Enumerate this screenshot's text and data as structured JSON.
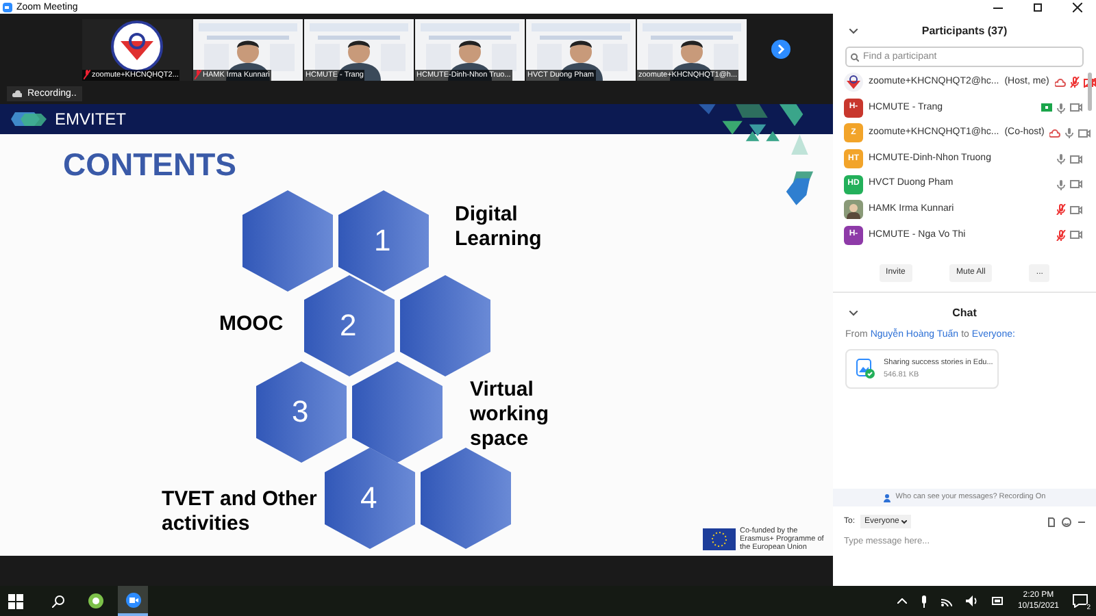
{
  "window": {
    "title": "Zoom Meeting"
  },
  "video_strip": [
    {
      "kind": "logo",
      "name": "zoomute+KHCNQHQT2...",
      "muted": true
    },
    {
      "kind": "picture",
      "name": "HAMK Irma Kunnari",
      "muted": true
    },
    {
      "kind": "picture",
      "name": "HCMUTE - Trang",
      "muted": false
    },
    {
      "kind": "picture",
      "name": "HCMUTE-Dinh-Nhon Truo...",
      "muted": false
    },
    {
      "kind": "picture",
      "name": "HVCT Duong Pham",
      "muted": false
    },
    {
      "kind": "picture",
      "name": "zoomute+KHCNQHQT1@h...",
      "muted": false
    }
  ],
  "recording": "Recording..",
  "slide": {
    "brand": "EMVITET",
    "title": "CONTENTS",
    "items": [
      {
        "number": "1",
        "label": "Digital Learning"
      },
      {
        "number": "2",
        "label": "MOOC"
      },
      {
        "number": "3",
        "label": "Virtual working space"
      },
      {
        "number": "4",
        "label": "TVET and Other activities"
      }
    ],
    "funding": "Co-funded by the Erasmus+ Programme of the European Union"
  },
  "participants": {
    "title": "Participants (37)",
    "search": {
      "placeholder": "Find a participant"
    },
    "rows": [
      {
        "kind": "logo",
        "name": "zoomute+KHCNQHQT2@hc...",
        "role": "(Host, me)",
        "cloud_recording": true,
        "screen_sharing": false,
        "mic_muted": true,
        "video_off": true
      },
      {
        "kind": "initials",
        "initials": "H-",
        "color": "#c8372d",
        "name": "HCMUTE - Trang",
        "cloud_recording": false,
        "screen_sharing": true,
        "mic_muted": false,
        "video_off": false
      },
      {
        "kind": "initials",
        "initials": "Z",
        "color": "#f2a42a",
        "name": "zoomute+KHCNQHQT1@hc...",
        "role": "(Co-host)",
        "cloud_recording": true,
        "screen_sharing": false,
        "mic_muted": false,
        "video_off": false
      },
      {
        "kind": "initials",
        "initials": "HT",
        "color": "#f2a42a",
        "name": "HCMUTE-Dinh-Nhon Truong",
        "cloud_recording": false,
        "screen_sharing": false,
        "mic_muted": false,
        "video_off": false
      },
      {
        "kind": "initials",
        "initials": "HD",
        "color": "#23b05a",
        "name": "HVCT Duong Pham",
        "cloud_recording": false,
        "screen_sharing": false,
        "mic_muted": false,
        "video_off": false
      },
      {
        "name": "HAMK Irma Kunnari",
        "cloud_recording": false,
        "screen_sharing": false,
        "mic_muted": true,
        "video_off": false
      },
      {
        "kind": "initials",
        "initials": "H-",
        "color": "#8e3aa8",
        "name": "HCMUTE - Nga Vo Thi",
        "cloud_recording": false,
        "screen_sharing": false,
        "mic_muted": true,
        "video_off": false
      }
    ],
    "buttons": [
      "Invite",
      "Mute All",
      "..."
    ]
  },
  "chat": {
    "title": "Chat",
    "from": "From",
    "sender": "Nguyễn Hoàng Tuấn",
    "to": "to",
    "recipient": "Everyone:",
    "file": {
      "name": "Sharing success stories in Edu...",
      "size": "546.81 KB"
    },
    "notice": "Who can see your messages? Recording On",
    "to_label": "To:",
    "to_value": "Everyone",
    "placeholder": "Type message here..."
  },
  "taskbar": {
    "time": "2:20 PM",
    "date": "10/15/2021",
    "notifications": "2"
  }
}
